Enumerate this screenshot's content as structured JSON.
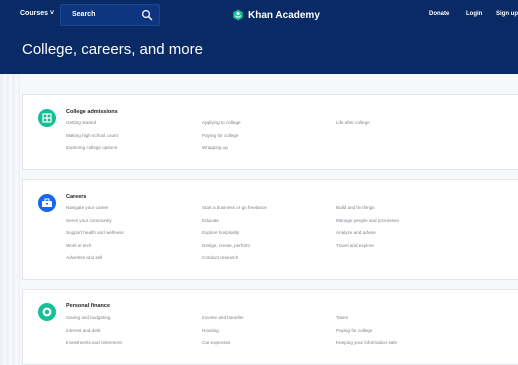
{
  "nav": {
    "courses_label": "Courses ˅",
    "search_label": "Search",
    "logo_text": "Khan Academy",
    "donate_label": "Donate",
    "login_label": "Login",
    "signup_label": "Sign up"
  },
  "banner": {
    "title": "College, careers, and more"
  },
  "sections": [
    {
      "title": "College admissions",
      "columns": [
        [
          "Getting started",
          "Making high school count",
          "Exploring college options"
        ],
        [
          "Applying to college",
          "Paying for college",
          "Wrapping up"
        ],
        [
          "Life after college"
        ]
      ]
    },
    {
      "title": "Careers",
      "columns": [
        [
          "Navigate your career",
          "Serve your community",
          "Support health and wellness",
          "Work in tech",
          "Advertise and sell"
        ],
        [
          "Start a business or go freelance",
          "Educate",
          "Explore hospitality",
          "Design, create, perform",
          "Conduct research"
        ],
        [
          "Build and fix things",
          "Manage people and processes",
          "Analyze and advise",
          "Travel and explore"
        ]
      ]
    },
    {
      "title": "Personal finance",
      "columns": [
        [
          "Saving and budgeting",
          "Interest and debt",
          "Investments and retirement"
        ],
        [
          "Income and benefits",
          "Housing",
          "Car expenses"
        ],
        [
          "Taxes",
          "Paying for college",
          "Keeping your information safe"
        ]
      ]
    }
  ]
}
